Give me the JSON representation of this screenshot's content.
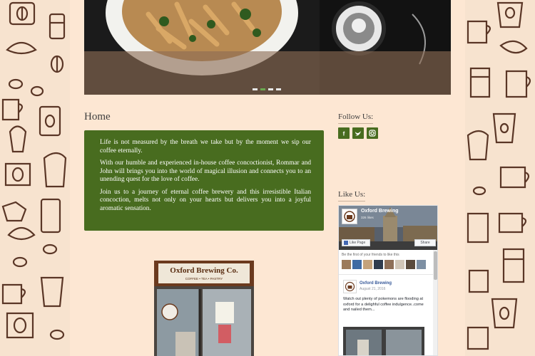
{
  "colors": {
    "background": "#f7e3cf",
    "page": "#fde7d3",
    "accent_green": "#486c1f",
    "doodle": "#5a3626"
  },
  "main": {
    "title": "Home",
    "intro": [
      "Life is not measured by the breath we take but by the moment we sip our coffee eternally.",
      "With our humble and experienced in-house coffee concoctionist, Rommar and John will brings you into the world of magical illusion and connects you to an unending quest for the love of coffee.",
      "Join us to a journey of eternal coffee brewery and this irresistible Italian concoction, melts not only on your hearts but delivers you into a joyful aromatic sensation."
    ],
    "storefront_sign": "Oxford Brewing Co.",
    "storefront_subsign": "COFFEE • TEA • PASTRY"
  },
  "slider": {
    "slide_count": 4,
    "active_slide": 2
  },
  "sidebar": {
    "follow_title": "Follow Us:",
    "social": [
      {
        "icon": "facebook-icon",
        "glyph": "f"
      },
      {
        "icon": "twitter-icon",
        "glyph": "t"
      },
      {
        "icon": "instagram-icon",
        "glyph": "◎"
      }
    ],
    "like_title": "Like Us:"
  },
  "facebook": {
    "page_name": "Oxford Brewing",
    "likes": "326 likes",
    "like_button": "Like Page",
    "share_button": "Share",
    "friends_text": "Be the first of your friends to like this",
    "post_author": "Oxford Brewing",
    "post_date": "August 21, 2016",
    "post_text": "Watch out plenty of pokemons are flooding at oxford for a delighful coffee indulgence..come and nailed them..."
  }
}
